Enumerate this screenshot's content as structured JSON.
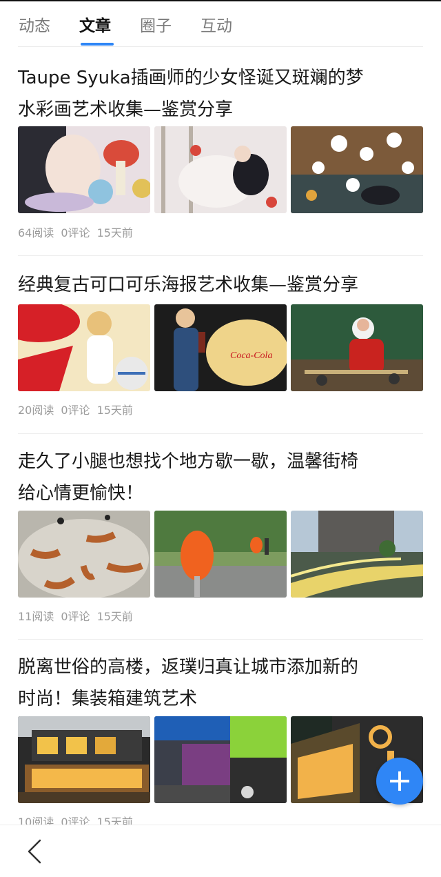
{
  "tabs": [
    {
      "label": "动态"
    },
    {
      "label": "文章"
    },
    {
      "label": "圈子"
    },
    {
      "label": "互动"
    }
  ],
  "active_tab": "文章",
  "accent_color": "#2f86f6",
  "articles": [
    {
      "title_line1": "Taupe Syuka插画师的少女怪诞又斑斓的梦",
      "title_line2": "水彩画艺术收集—鉴赏分享",
      "reads": "64阅读",
      "comments": "0评论",
      "time": "15天前",
      "images": [
        "watercolor-girl-mushroom-illustration",
        "watercolor-girl-reclining-illustration",
        "watercolor-girl-flowers-illustration"
      ]
    },
    {
      "title_line1": "经典复古可口可乐海报艺术收集—鉴赏分享",
      "title_line2": "",
      "reads": "20阅读",
      "comments": "0评论",
      "time": "15天前",
      "images": [
        "coca-cola-beach-girl-poster",
        "coca-cola-swimsuit-poster",
        "coca-cola-santa-poster"
      ],
      "image_text": "Coca-Cola"
    },
    {
      "title_line1": "走久了小腿也想找个地方歇一歇，温馨街椅",
      "title_line2": "给心情更愉快！",
      "reads": "11阅读",
      "comments": "0评论",
      "time": "15天前",
      "images": [
        "sculpted-benches-plaza",
        "orange-egg-chair-street",
        "lit-curved-bench-night"
      ]
    },
    {
      "title_line1": "脱离世俗的高楼，返璞归真让城市添加新的",
      "title_line2": "时尚！集装箱建筑艺术",
      "reads": "10阅读",
      "comments": "0评论",
      "time": "15天前",
      "images": [
        "container-house-night",
        "container-building-green-glass",
        "container-building-dark"
      ]
    }
  ],
  "bottom_bar": {
    "back_icon": "chevron-left-icon"
  },
  "fab": {
    "icon": "plus-icon"
  }
}
